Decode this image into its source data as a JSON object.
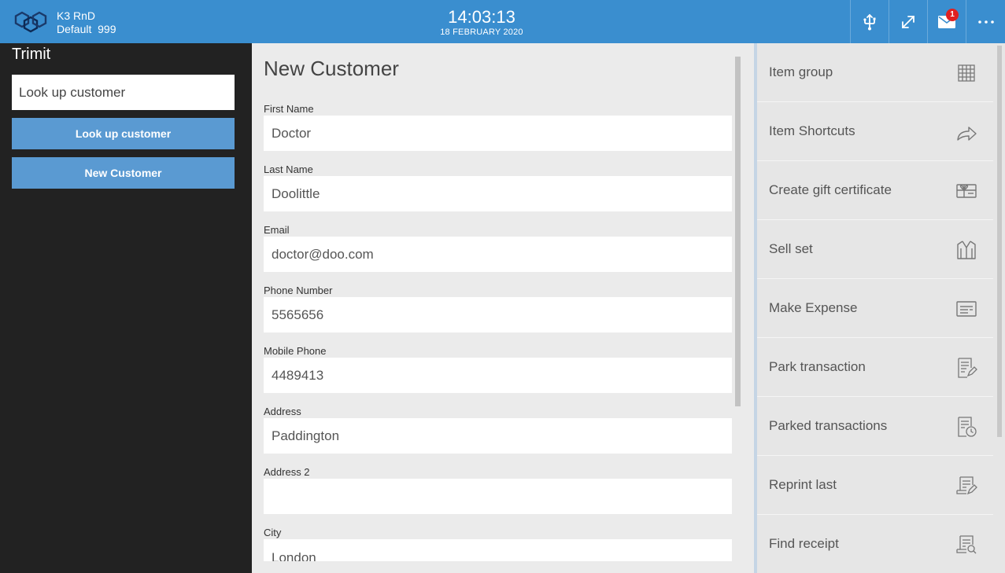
{
  "header": {
    "company": "K3 RnD",
    "store": "Default  999",
    "time": "14:03:13",
    "date": "18 FEBRUARY 2020",
    "notification_count": "1",
    "colors": {
      "bar": "#3a8ecf",
      "badge": "#e02020"
    },
    "icons": [
      "usb-icon",
      "expand-icon",
      "mail-icon",
      "more-icon"
    ]
  },
  "left": {
    "title": "Trimit",
    "search_placeholder": "Look up customer",
    "lookup_button": "Look up customer",
    "new_button": "New Customer"
  },
  "form": {
    "title": "New Customer",
    "fields": [
      {
        "label": "First Name",
        "value": "Doctor"
      },
      {
        "label": "Last Name",
        "value": "Doolittle"
      },
      {
        "label": "Email",
        "value": "doctor@doo.com"
      },
      {
        "label": "Phone Number",
        "value": "5565656"
      },
      {
        "label": "Mobile Phone",
        "value": "4489413"
      },
      {
        "label": "Address",
        "value": "Paddington"
      },
      {
        "label": "Address 2",
        "value": ""
      },
      {
        "label": "City",
        "value": "London"
      }
    ]
  },
  "actions": [
    {
      "label": "Item group",
      "icon": "grid-icon"
    },
    {
      "label": "Item Shortcuts",
      "icon": "share-arrow-icon"
    },
    {
      "label": "Create gift certificate",
      "icon": "gift-card-icon"
    },
    {
      "label": "Sell set",
      "icon": "jacket-icon"
    },
    {
      "label": "Make Expense",
      "icon": "expense-doc-icon"
    },
    {
      "label": "Park transaction",
      "icon": "park-receipt-icon"
    },
    {
      "label": "Parked transactions",
      "icon": "parked-clock-icon"
    },
    {
      "label": "Reprint last",
      "icon": "reprint-icon"
    },
    {
      "label": "Find receipt",
      "icon": "find-receipt-icon"
    }
  ]
}
